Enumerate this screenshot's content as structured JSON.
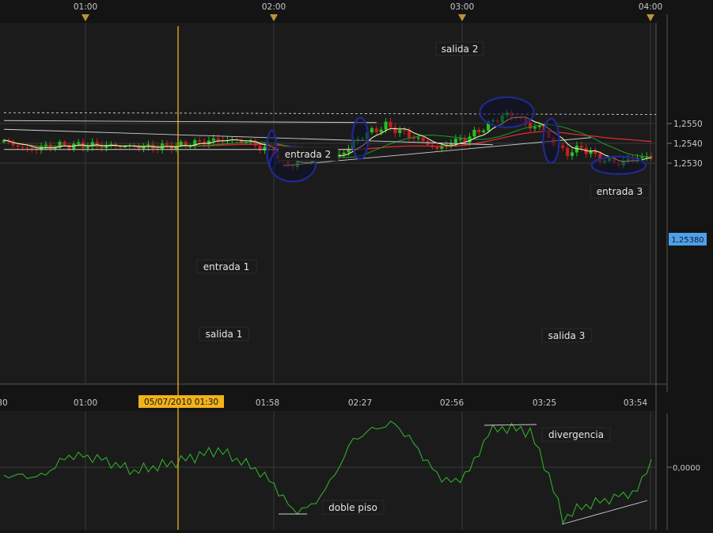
{
  "colors": {
    "background": "#141414",
    "panel": "#1b1b1b",
    "grid": "#3a3a3a",
    "axis_text": "#c8c8c8",
    "bull": "#22c31f",
    "bear": "#c81e1e",
    "ma_slow": "#d62a2a",
    "ma_mid": "#1e9a28",
    "ma_fast": "#f0efb0",
    "trend": "#cfcfcf",
    "oscillator": "#2fae2a",
    "cursor": "#f2b21a",
    "price_badge": "#4fa0e8",
    "ellipse": "#1f2a8f",
    "label_bg": "#1a1a1a"
  },
  "top_axis": {
    "ticks": [
      "01:00",
      "02:00",
      "03:00",
      "04:00"
    ]
  },
  "bottom_axis": {
    "ticks": [
      "30",
      "01:00",
      "01:58",
      "02:27",
      "02:56",
      "03:25",
      "03:54"
    ]
  },
  "cursor_label": "05/07/2010 01:30",
  "price_axis": {
    "ticks": [
      "1,2550",
      "1,2540",
      "1,2530"
    ],
    "current": "1,25380"
  },
  "oscillator_axis": {
    "ticks": [
      "0,0000"
    ]
  },
  "annotations": {
    "entrada1": "entrada 1",
    "entrada2": "entrada 2",
    "entrada3": "entrada 3",
    "salida1": "salida 1",
    "salida2": "salida 2",
    "salida3": "salida 3",
    "divergencia": "divergencia",
    "doble_piso": "doble piso"
  },
  "chart_data": {
    "type": "candlestick",
    "ylim": [
      1.2522,
      1.2559
    ],
    "y_ticks": [
      1.253,
      1.254,
      1.255
    ],
    "current_price": 1.2538,
    "n_bars": 140,
    "trend_lines": [
      {
        "name": "falling-1",
        "from": [
          0,
          1.25555
        ],
        "to": [
          140,
          1.25546
        ]
      },
      {
        "name": "falling-2",
        "from": [
          0,
          1.25515
        ],
        "to": [
          80,
          1.25505
        ]
      },
      {
        "name": "falling-3",
        "from": [
          0,
          1.25471
        ],
        "to": [
          105,
          1.25393
        ]
      },
      {
        "name": "rising",
        "from": [
          60,
          1.25287
        ],
        "to": [
          126,
          1.25429
        ]
      },
      {
        "name": "support",
        "from": [
          0,
          1.25369
        ],
        "to": [
          76,
          1.25369
        ]
      }
    ],
    "ellipses": [
      {
        "label": "entrada1",
        "at": [
          57.5,
          1.25368
        ]
      },
      {
        "label": "salida1",
        "at": [
          62,
          1.25295
        ]
      },
      {
        "label": "entrada2",
        "at": [
          76.5,
          1.25425
        ]
      },
      {
        "label": "salida2",
        "at": [
          108,
          1.25557
        ]
      },
      {
        "label": "entrada3",
        "at": [
          117.5,
          1.25413
        ]
      },
      {
        "label": "salida3",
        "at": [
          132,
          1.25289
        ]
      }
    ],
    "oscillator_zero": 0
  }
}
